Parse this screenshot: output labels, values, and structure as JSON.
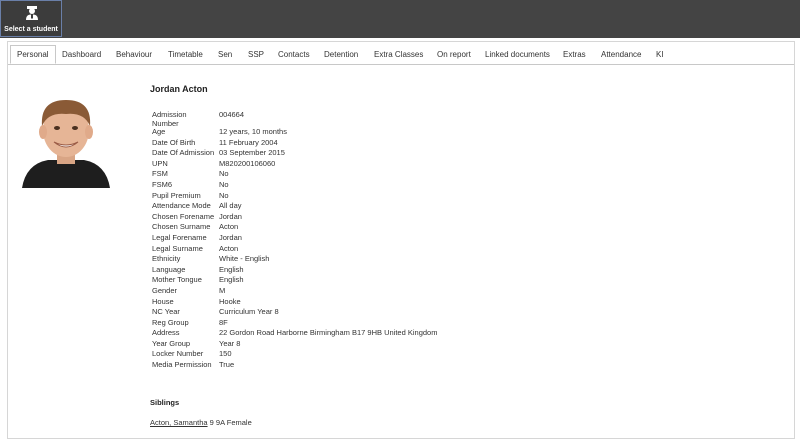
{
  "topbar": {
    "select_student_label": "Select a student",
    "icon": "student-icon"
  },
  "tabs": [
    {
      "label": "Personal",
      "active": true
    },
    {
      "label": "Dashboard"
    },
    {
      "label": "Behaviour"
    },
    {
      "label": "Timetable"
    },
    {
      "label": "Sen"
    },
    {
      "label": "SSP"
    },
    {
      "label": "Contacts"
    },
    {
      "label": "Detention"
    },
    {
      "label": "Extra Classes"
    },
    {
      "label": "On report"
    },
    {
      "label": "Linked documents"
    },
    {
      "label": "Extras"
    },
    {
      "label": "Attendance"
    },
    {
      "label": "KI"
    }
  ],
  "student": {
    "name": "Jordan Acton",
    "fields": [
      {
        "key": "Admission Number",
        "value": "004664"
      },
      {
        "key": "Age",
        "value": "12 years, 10 months"
      },
      {
        "key": "Date Of Birth",
        "value": "11 February 2004"
      },
      {
        "key": "Date Of Admission",
        "value": "03 September 2015"
      },
      {
        "key": "UPN",
        "value": "M820200106060"
      },
      {
        "key": "FSM",
        "value": "No"
      },
      {
        "key": "FSM6",
        "value": "No"
      },
      {
        "key": "Pupil Premium",
        "value": "No"
      },
      {
        "key": "Attendance Mode",
        "value": "All day"
      },
      {
        "key": "Chosen Forename",
        "value": "Jordan"
      },
      {
        "key": "Chosen Surname",
        "value": "Acton"
      },
      {
        "key": "Legal Forename",
        "value": "Jordan"
      },
      {
        "key": "Legal Surname",
        "value": "Acton"
      },
      {
        "key": "Ethnicity",
        "value": "White - English"
      },
      {
        "key": "Language",
        "value": "English"
      },
      {
        "key": "Mother Tongue",
        "value": "English"
      },
      {
        "key": "Gender",
        "value": "M"
      },
      {
        "key": "House",
        "value": "Hooke"
      },
      {
        "key": "NC Year",
        "value": "Curriculum Year 8"
      },
      {
        "key": "Reg Group",
        "value": "8F"
      },
      {
        "key": "Address",
        "value": "22 Gordon Road Harborne Birmingham B17 9HB United Kingdom"
      },
      {
        "key": "Year Group",
        "value": "Year 8"
      },
      {
        "key": "Locker Number",
        "value": "150"
      },
      {
        "key": "Media Permission",
        "value": "True"
      }
    ]
  },
  "siblings": {
    "heading": "Siblings",
    "items": [
      {
        "name": "Acton, Samantha",
        "details": "9 9A Female"
      }
    ]
  }
}
